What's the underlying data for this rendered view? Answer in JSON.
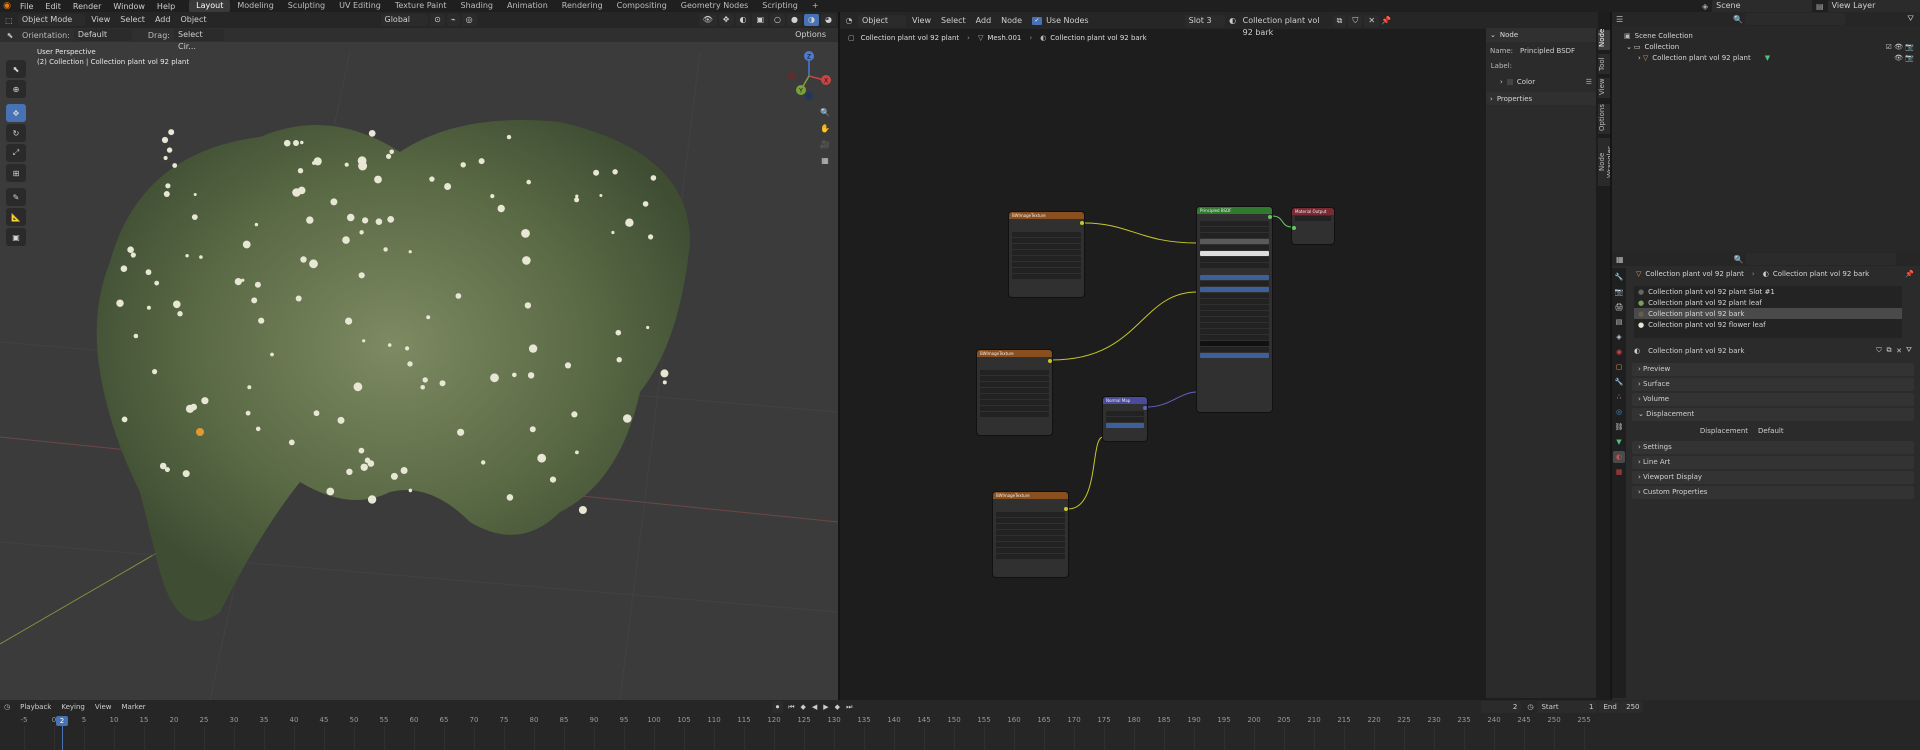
{
  "topbar": {
    "menus": [
      "File",
      "Edit",
      "Render",
      "Window",
      "Help"
    ],
    "workspaces": [
      "Layout",
      "Modeling",
      "Sculpting",
      "UV Editing",
      "Texture Paint",
      "Shading",
      "Animation",
      "Rendering",
      "Compositing",
      "Geometry Nodes",
      "Scripting"
    ],
    "active_workspace": "Layout",
    "add_tab": "+",
    "scene": "Scene",
    "view_layer": "View Layer"
  },
  "viewport": {
    "mode": "Object Mode",
    "menus": [
      "View",
      "Select",
      "Add",
      "Object"
    ],
    "transform": "Global",
    "orientation_label": "Orientation:",
    "orientation_value": "Default",
    "drag_label": "Drag:",
    "drag_value": "Select Cir...",
    "options": "Options",
    "perspective": "User Perspective",
    "collection_info": "(2) Collection | Collection plant vol 92 plant",
    "gizmo": {
      "x": "X",
      "y": "Y",
      "z": "Z"
    }
  },
  "node_editor": {
    "type": "Object",
    "menus": [
      "View",
      "Select",
      "Add",
      "Node"
    ],
    "use_nodes_label": "Use Nodes",
    "slot": "Slot 3",
    "material": "Collection plant vol 92 bark",
    "breadcrumb": [
      "Collection plant vol 92 plant",
      "Mesh.001",
      "Collection plant vol 92 bark"
    ],
    "nodes": {
      "tex1": "BWImageTexture",
      "tex2": "BWImageTexture",
      "tex3": "BWImageTexture",
      "bsdf": "Principled BSDF",
      "output": "Material Output",
      "normal": "Normal Map"
    }
  },
  "npanel": {
    "section": "Node",
    "name_label": "Name:",
    "name_value": "Principled BSDF",
    "label_label": "Label:",
    "color": "Color",
    "properties": "Properties",
    "tabs": [
      "Node",
      "Tool",
      "View",
      "Options",
      "Node Wrangler"
    ]
  },
  "outliner": {
    "scene_collection": "Scene Collection",
    "collection": "Collection",
    "object": "Collection plant vol 92 plant"
  },
  "properties": {
    "breadcrumb_object": "Collection plant vol 92 plant",
    "breadcrumb_material": "Collection plant vol 92 bark",
    "slots": [
      "Collection plant vol 92 plant  Slot #1",
      "Collection plant vol 92 plant  leaf",
      "Collection plant vol 92 bark",
      "Collection plant vol 92 flower leaf"
    ],
    "material_field": "Collection plant vol 92 bark",
    "panels": [
      "Preview",
      "Surface",
      "Volume",
      "Displacement"
    ],
    "displacement_label": "Displacement",
    "displacement_value": "Default",
    "panels_bottom": [
      "Settings",
      "Line Art",
      "Viewport Display",
      "Custom Properties"
    ]
  },
  "timeline": {
    "menus": [
      "Playback",
      "Keying",
      "View",
      "Marker"
    ],
    "current_frame": "2",
    "start_label": "Start",
    "start": "1",
    "end_label": "End",
    "end": "250",
    "ticks": [
      "-5",
      "0",
      "5",
      "10",
      "15",
      "20",
      "25",
      "30",
      "35",
      "40",
      "45",
      "50",
      "55",
      "60",
      "65",
      "70",
      "75",
      "80",
      "85",
      "90",
      "95",
      "100",
      "105",
      "110",
      "115",
      "120",
      "125",
      "130",
      "135",
      "140",
      "145",
      "150",
      "155",
      "160",
      "165",
      "170",
      "175",
      "180",
      "185",
      "190",
      "195",
      "200",
      "205",
      "210",
      "215",
      "220",
      "225",
      "230",
      "235",
      "240",
      "245",
      "250",
      "255"
    ]
  }
}
